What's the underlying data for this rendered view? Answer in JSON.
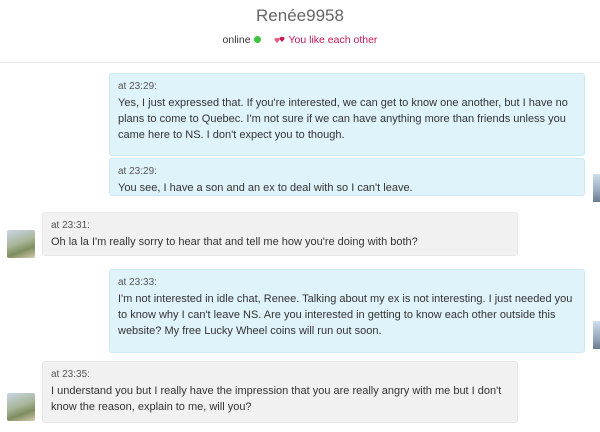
{
  "header": {
    "username": "Renée9958",
    "status": "online",
    "match_text": "You like each other",
    "colors": {
      "online_dot": "#3cc43c",
      "match": "#c2185b"
    }
  },
  "messages": [
    {
      "side": "out",
      "time": "at 23:29:",
      "text": "Yes, I just expressed that. If you're interested, we can get to know one another, but I have no plans to come to Quebec. I'm not sure if we can have anything more than friends unless you came here to NS. I don't expect you to though."
    },
    {
      "side": "out",
      "time": "at 23:29:",
      "text": "You see, I have a son and an ex to deal with so I can't leave."
    },
    {
      "side": "in",
      "time": "at 23:31:",
      "text": "Oh la la I'm really sorry to hear that and tell me how you're doing with both?"
    },
    {
      "side": "out",
      "time": "at 23:33:",
      "text": "I'm not interested in idle chat, Renee. Talking about my ex is not interesting. I just needed you to know why I can't leave NS. Are you interested in getting to know each other outside this website? My free Lucky Wheel coins will run out soon."
    },
    {
      "side": "in",
      "time": "at 23:35:",
      "text": "I understand you but I really have the impression that you are really angry with me but I don't know the reason, explain to me, will you?"
    }
  ]
}
